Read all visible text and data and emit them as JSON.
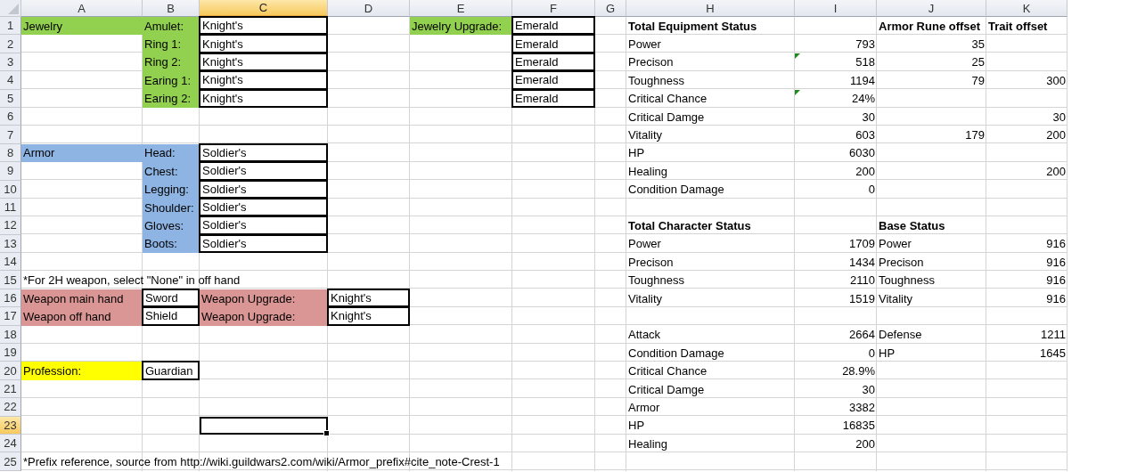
{
  "columns": [
    {
      "label": "A",
      "selected": false
    },
    {
      "label": "B",
      "selected": false
    },
    {
      "label": "C",
      "selected": true
    },
    {
      "label": "D",
      "selected": false
    },
    {
      "label": "E",
      "selected": false
    },
    {
      "label": "F",
      "selected": false
    },
    {
      "label": "G",
      "selected": false
    },
    {
      "label": "H",
      "selected": false
    },
    {
      "label": "I",
      "selected": false
    },
    {
      "label": "J",
      "selected": false
    },
    {
      "label": "K",
      "selected": false
    }
  ],
  "rows": [
    {
      "number": "1",
      "selected": false,
      "cells": {
        "a": {
          "text": "Jewelry",
          "color": "#92d050",
          "selected": false
        },
        "b": {
          "text": "Amulet:",
          "color": "#92d050",
          "selected": false
        },
        "c": {
          "text": "Knight's",
          "boxed": true,
          "selected": false
        },
        "e": {
          "text": "Jewelry Upgrade:",
          "color": "#92d050",
          "selected": false
        },
        "f": {
          "text": "Emerald",
          "boxed": true,
          "selected": false
        },
        "h": {
          "text": "Total Equipment Status",
          "bold": true,
          "selected": false
        },
        "j": {
          "text": "Armor Rune offset",
          "bold": true,
          "selected": false
        },
        "k": {
          "text": "Trait offset",
          "bold": true,
          "selected": false
        }
      }
    },
    {
      "number": "2",
      "selected": false,
      "cells": {
        "b": {
          "text": "Ring 1:",
          "color": "#92d050",
          "selected": false
        },
        "c": {
          "text": "Knight's",
          "boxed": true,
          "selected": false
        },
        "f": {
          "text": "Emerald",
          "boxed": true,
          "selected": false
        },
        "h": {
          "text": "Power",
          "selected": false
        },
        "i": {
          "text": "793",
          "kind": "number",
          "selected": false
        },
        "j": {
          "text": "35",
          "kind": "number",
          "selected": false
        }
      }
    },
    {
      "number": "3",
      "selected": false,
      "cells": {
        "b": {
          "text": "Ring 2:",
          "color": "#92d050",
          "selected": false
        },
        "c": {
          "text": "Knight's",
          "boxed": true,
          "selected": false
        },
        "f": {
          "text": "Emerald",
          "boxed": true,
          "selected": false
        },
        "h": {
          "text": "Precison",
          "selected": false
        },
        "i": {
          "text": "518",
          "kind": "number",
          "flagged": true,
          "selected": false
        },
        "j": {
          "text": "25",
          "kind": "number",
          "selected": false
        }
      }
    },
    {
      "number": "4",
      "selected": false,
      "cells": {
        "b": {
          "text": "Earing 1:",
          "color": "#92d050",
          "selected": false
        },
        "c": {
          "text": "Knight's",
          "boxed": true,
          "selected": false
        },
        "f": {
          "text": "Emerald",
          "boxed": true,
          "selected": false
        },
        "h": {
          "text": "Toughness",
          "selected": false
        },
        "i": {
          "text": "1194",
          "kind": "number",
          "selected": false
        },
        "j": {
          "text": "79",
          "kind": "number",
          "selected": false
        },
        "k": {
          "text": "300",
          "kind": "number",
          "selected": false
        }
      }
    },
    {
      "number": "5",
      "selected": false,
      "cells": {
        "b": {
          "text": "Earing 2:",
          "color": "#92d050",
          "selected": false
        },
        "c": {
          "text": "Knight's",
          "boxed": true,
          "selected": false
        },
        "f": {
          "text": "Emerald",
          "boxed": true,
          "selected": false
        },
        "h": {
          "text": "Critical Chance",
          "selected": false
        },
        "i": {
          "text": "24%",
          "kind": "number",
          "flagged": true,
          "selected": false
        }
      }
    },
    {
      "number": "6",
      "selected": false,
      "cells": {
        "h": {
          "text": "Critical Damge",
          "selected": false
        },
        "i": {
          "text": "30",
          "kind": "number",
          "selected": false
        },
        "k": {
          "text": "30",
          "kind": "number",
          "selected": false
        }
      }
    },
    {
      "number": "7",
      "selected": false,
      "cells": {
        "h": {
          "text": "Vitality",
          "selected": false
        },
        "i": {
          "text": "603",
          "kind": "number",
          "selected": false
        },
        "j": {
          "text": "179",
          "kind": "number",
          "selected": false
        },
        "k": {
          "text": "200",
          "kind": "number",
          "selected": false
        }
      }
    },
    {
      "number": "8",
      "selected": false,
      "cells": {
        "a": {
          "text": "Armor",
          "color": "#8db4e2",
          "selected": false
        },
        "b": {
          "text": "Head:",
          "color": "#8db4e2",
          "selected": false
        },
        "c": {
          "text": "Soldier's",
          "boxed": true,
          "selected": false
        },
        "h": {
          "text": "HP",
          "selected": false
        },
        "i": {
          "text": "6030",
          "kind": "number",
          "selected": false
        }
      }
    },
    {
      "number": "9",
      "selected": false,
      "cells": {
        "b": {
          "text": "Chest:",
          "color": "#8db4e2",
          "selected": false
        },
        "c": {
          "text": "Soldier's",
          "boxed": true,
          "selected": false
        },
        "h": {
          "text": "Healing",
          "selected": false
        },
        "i": {
          "text": "200",
          "kind": "number",
          "selected": false
        },
        "k": {
          "text": "200",
          "kind": "number",
          "selected": false
        }
      }
    },
    {
      "number": "10",
      "selected": false,
      "cells": {
        "b": {
          "text": "Legging:",
          "color": "#8db4e2",
          "selected": false
        },
        "c": {
          "text": "Soldier's",
          "boxed": true,
          "selected": false
        },
        "h": {
          "text": "Condition Damage",
          "selected": false
        },
        "i": {
          "text": "0",
          "kind": "number",
          "selected": false
        }
      }
    },
    {
      "number": "11",
      "selected": false,
      "cells": {
        "b": {
          "text": "Shoulder:",
          "color": "#8db4e2",
          "selected": false
        },
        "c": {
          "text": "Soldier's",
          "boxed": true,
          "selected": false
        }
      }
    },
    {
      "number": "12",
      "selected": false,
      "cells": {
        "b": {
          "text": "Gloves:",
          "color": "#8db4e2",
          "selected": false
        },
        "c": {
          "text": "Soldier's",
          "boxed": true,
          "selected": false
        },
        "h": {
          "text": "Total Character Status",
          "bold": true,
          "selected": false
        },
        "j": {
          "text": "Base Status",
          "bold": true,
          "selected": false
        }
      }
    },
    {
      "number": "13",
      "selected": false,
      "cells": {
        "b": {
          "text": "Boots:",
          "color": "#8db4e2",
          "selected": false
        },
        "c": {
          "text": "Soldier's",
          "boxed": true,
          "selected": false
        },
        "h": {
          "text": "Power",
          "selected": false
        },
        "i": {
          "text": "1709",
          "kind": "number",
          "selected": false
        },
        "j": {
          "text": "Power",
          "selected": false
        },
        "k": {
          "text": "916",
          "kind": "number",
          "selected": false
        }
      }
    },
    {
      "number": "14",
      "selected": false,
      "cells": {
        "h": {
          "text": "Precison",
          "selected": false
        },
        "i": {
          "text": "1434",
          "kind": "number",
          "selected": false
        },
        "j": {
          "text": "Precison",
          "selected": false
        },
        "k": {
          "text": "916",
          "kind": "number",
          "selected": false
        }
      }
    },
    {
      "number": "15",
      "selected": false,
      "cells": {
        "a": {
          "text": "*For 2H weapon, select \"None\" in off hand",
          "selected": false
        },
        "h": {
          "text": "Toughness",
          "selected": false
        },
        "i": {
          "text": "2110",
          "kind": "number",
          "selected": false
        },
        "j": {
          "text": "Toughness",
          "selected": false
        },
        "k": {
          "text": "916",
          "kind": "number",
          "selected": false
        }
      }
    },
    {
      "number": "16",
      "selected": false,
      "cells": {
        "a": {
          "text": "Weapon main hand",
          "color": "#da9694",
          "selected": false
        },
        "b": {
          "text": "Sword",
          "boxed": true,
          "selected": false
        },
        "c": {
          "text": "Weapon Upgrade:",
          "color": "#da9694",
          "selected": false
        },
        "d": {
          "text": "Knight's",
          "boxed": true,
          "selected": false
        },
        "h": {
          "text": "Vitality",
          "selected": false
        },
        "i": {
          "text": "1519",
          "kind": "number",
          "selected": false
        },
        "j": {
          "text": "Vitality",
          "selected": false
        },
        "k": {
          "text": "916",
          "kind": "number",
          "selected": false
        }
      }
    },
    {
      "number": "17",
      "selected": false,
      "cells": {
        "a": {
          "text": "Weapon off hand",
          "color": "#da9694",
          "selected": false
        },
        "b": {
          "text": "Shield",
          "boxed": true,
          "selected": false
        },
        "c": {
          "text": "Weapon Upgrade:",
          "color": "#da9694",
          "selected": false
        },
        "d": {
          "text": "Knight's",
          "boxed": true,
          "selected": false
        }
      }
    },
    {
      "number": "18",
      "selected": false,
      "cells": {
        "h": {
          "text": "Attack",
          "selected": false
        },
        "i": {
          "text": "2664",
          "kind": "number",
          "selected": false
        },
        "j": {
          "text": "Defense",
          "selected": false
        },
        "k": {
          "text": "1211",
          "kind": "number",
          "selected": false
        }
      }
    },
    {
      "number": "19",
      "selected": false,
      "cells": {
        "h": {
          "text": "Condition Damage",
          "selected": false
        },
        "i": {
          "text": "0",
          "kind": "number",
          "selected": false
        },
        "j": {
          "text": "HP",
          "selected": false
        },
        "k": {
          "text": "1645",
          "kind": "number",
          "selected": false
        }
      }
    },
    {
      "number": "20",
      "selected": false,
      "cells": {
        "a": {
          "text": "Profession:",
          "color": "#ffff00",
          "selected": false
        },
        "b": {
          "text": "Guardian",
          "boxed": true,
          "selected": false
        },
        "h": {
          "text": "Critical Chance",
          "selected": false
        },
        "i": {
          "text": "28.9%",
          "kind": "number",
          "selected": false
        }
      }
    },
    {
      "number": "21",
      "selected": false,
      "cells": {
        "h": {
          "text": "Critical Damge",
          "selected": false
        },
        "i": {
          "text": "30",
          "kind": "number",
          "selected": false
        }
      }
    },
    {
      "number": "22",
      "selected": false,
      "cells": {
        "h": {
          "text": "Armor",
          "selected": false
        },
        "i": {
          "text": "3382",
          "kind": "number",
          "selected": false
        }
      }
    },
    {
      "number": "23",
      "selected": true,
      "cells": {
        "c": {
          "selected": true
        },
        "h": {
          "text": "HP",
          "selected": false
        },
        "i": {
          "text": "16835",
          "kind": "number",
          "selected": false
        }
      }
    },
    {
      "number": "24",
      "selected": false,
      "cells": {
        "h": {
          "text": "Healing",
          "selected": false
        },
        "i": {
          "text": "200",
          "kind": "number",
          "selected": false
        }
      }
    },
    {
      "number": "25",
      "selected": false,
      "cells": {
        "a": {
          "text": "*Prefix reference, source from http://wiki.guildwars2.com/wiki/Armor_prefix#cite_note-Crest-1",
          "selected": false
        }
      }
    }
  ]
}
